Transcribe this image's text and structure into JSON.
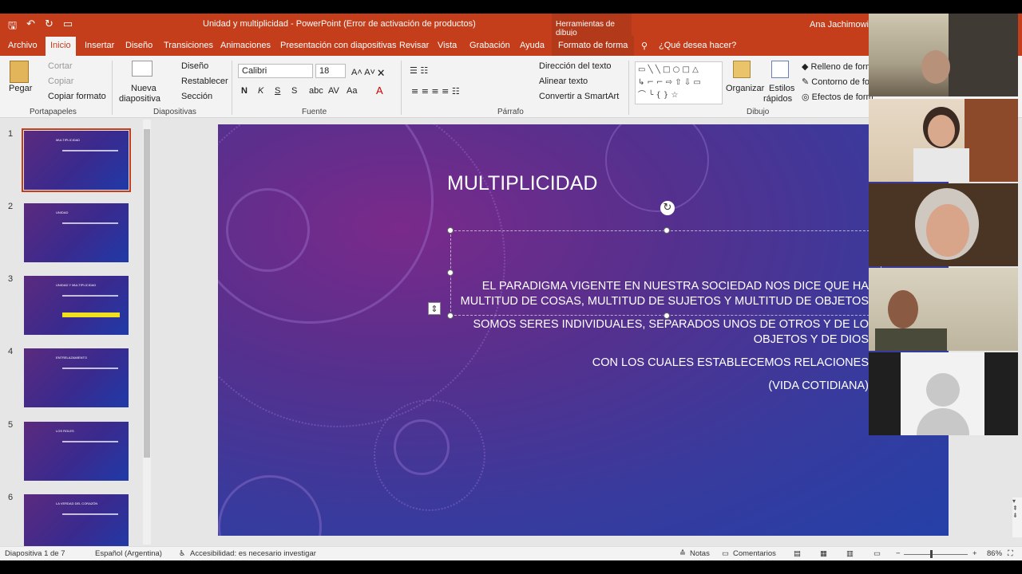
{
  "window": {
    "title": "Unidad y multiplicidad  -  PowerPoint (Error de activación de productos)",
    "context_header": "Herramientas de dibujo",
    "user": "Ana Jachimowicz"
  },
  "tabs": [
    "Archivo",
    "Inicio",
    "Insertar",
    "Diseño",
    "Transiciones",
    "Animaciones",
    "Presentación con diapositivas",
    "Revisar",
    "Vista",
    "Grabación",
    "Ayuda",
    "Formato de forma"
  ],
  "tell_me": "¿Qué desea hacer?",
  "ribbon": {
    "clipboard": {
      "paste": "Pegar",
      "cut": "Cortar",
      "copy": "Copiar",
      "format_painter": "Copiar formato",
      "group": "Portapapeles"
    },
    "slides": {
      "new_slide_1": "Nueva",
      "new_slide_2": "diapositiva",
      "layout": "Diseño",
      "reset": "Restablecer",
      "section": "Sección",
      "group": "Diapositivas"
    },
    "font": {
      "name": "Calibri",
      "size": "18",
      "group": "Fuente"
    },
    "paragraph": {
      "text_direction": "Dirección del texto",
      "align_text": "Alinear texto",
      "smartart": "Convertir a SmartArt",
      "group": "Párrafo"
    },
    "drawing": {
      "arrange": "Organizar",
      "quick_styles_1": "Estilos",
      "quick_styles_2": "rápidos",
      "fill": "Relleno de form",
      "outline": "Contorno de fo",
      "effects": "Efectos de form",
      "group": "Dibujo"
    }
  },
  "thumbnails": [
    {
      "num": "1",
      "title": "MULTIPLICIDAD"
    },
    {
      "num": "2",
      "title": "UNIDAD"
    },
    {
      "num": "3",
      "title": "UNIDAD Y MULTIPLICIDAD"
    },
    {
      "num": "4",
      "title": "ENTRELAZAMIENTO"
    },
    {
      "num": "5",
      "title": "LOS ROLES"
    },
    {
      "num": "6",
      "title": "LA VERDAD DEL CORAZÓN"
    }
  ],
  "slide": {
    "title": "MULTIPLICIDAD",
    "p1": "EL PARADIGMA VIGENTE EN NUESTRA SOCIEDAD NOS DICE QUE HA MULTITUD DE COSAS, MULTITUD DE SUJETOS Y MULTITUD DE OBJETOS",
    "p2": "SOMOS SERES INDIVIDUALES, SEPARADOS UNOS DE OTROS Y DE LO OBJETOS Y DE DIOS",
    "p3": "CON LOS CUALES ESTABLECEMOS RELACIONES",
    "p4": "(VIDA COTIDIANA)"
  },
  "status": {
    "slide_count": "Diapositiva 1 de 7",
    "language": "Español (Argentina)",
    "accessibility": "Accesibilidad: es necesario investigar",
    "notes": "Notas",
    "comments": "Comentarios",
    "zoom": "86%"
  }
}
